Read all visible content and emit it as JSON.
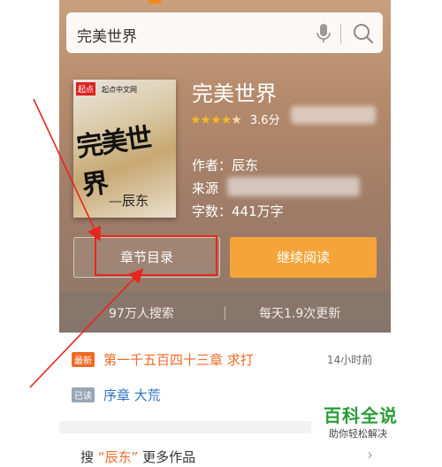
{
  "search": {
    "query": "完美世界"
  },
  "book": {
    "title": "完美世界",
    "rating": "3.6分",
    "author_line": "作者：辰东",
    "source_line": "来源",
    "wordcount_line": "字数：441万字",
    "cover": {
      "badge": "起点",
      "publisher": "起点中文网",
      "cover_title": "完美世界",
      "cover_author": "—辰东"
    }
  },
  "actions": {
    "toc_label": "章节目录",
    "continue_label": "继续阅读"
  },
  "stats": {
    "searches": "97万人搜索",
    "updates": "每天1.9次更新"
  },
  "chapters": [
    {
      "tag": "最新",
      "title": "第一千五百四十三章 求打",
      "time": "14小时前"
    },
    {
      "tag": "已读",
      "title": "序章 大荒"
    }
  ],
  "more": {
    "prefix": "搜",
    "author_quoted": "“辰东”",
    "suffix": "更多作品"
  },
  "watermark": {
    "title": "百科全说",
    "subtitle": "助你轻松解决"
  },
  "colors": {
    "accent_orange": "#f5a43a",
    "latest_tag": "#f06a25",
    "link_blue": "#2f72c6",
    "annotation_red": "#e8251c"
  }
}
